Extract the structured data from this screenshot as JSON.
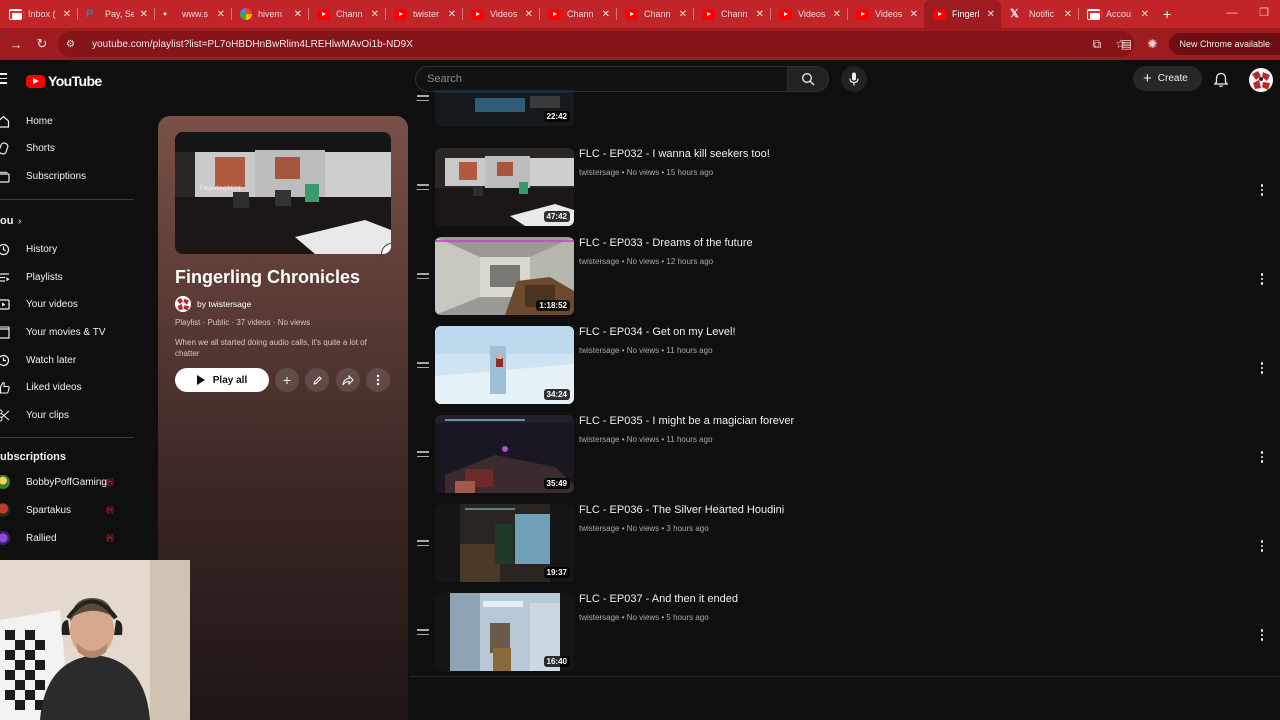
{
  "browser": {
    "tabs": [
      {
        "label": "Inbox (",
        "icon": "gmail-icon"
      },
      {
        "label": "Pay, Se",
        "icon": "paypal-icon"
      },
      {
        "label": "www.s",
        "icon": "web-icon"
      },
      {
        "label": "hivem",
        "icon": "google-icon"
      },
      {
        "label": "Chann",
        "icon": "youtube-icon"
      },
      {
        "label": "twister",
        "icon": "youtube-icon"
      },
      {
        "label": "Videos",
        "icon": "youtube-icon"
      },
      {
        "label": "Chann",
        "icon": "youtube-icon"
      },
      {
        "label": "Chann",
        "icon": "youtube-icon"
      },
      {
        "label": "Chann",
        "icon": "youtube-icon"
      },
      {
        "label": "Videos",
        "icon": "youtube-icon"
      },
      {
        "label": "Videos",
        "icon": "youtube-icon"
      },
      {
        "label": "Fingerl",
        "icon": "youtube-icon",
        "active": true
      },
      {
        "label": "Notific",
        "icon": "x-icon"
      },
      {
        "label": "Accou",
        "icon": "gmail-icon"
      }
    ],
    "url": "youtube.com/playlist?list=PL7oHBDHnBwRlim4LREHlwMAvOi1b-ND9X",
    "chrome_notice": "New Chrome available",
    "colors": {
      "tabstrip": "#c1252a",
      "toolbar": "#9e1b20"
    }
  },
  "masthead": {
    "logo_text": "YouTube",
    "search_placeholder": "Search",
    "create_label": "Create"
  },
  "sidebar": {
    "main": [
      {
        "label": "Home",
        "icon": "home-icon"
      },
      {
        "label": "Shorts",
        "icon": "shorts-icon"
      },
      {
        "label": "Subscriptions",
        "icon": "subscriptions-icon"
      }
    ],
    "you_header": "ou",
    "you": [
      {
        "label": "History",
        "icon": "history-icon"
      },
      {
        "label": "Playlists",
        "icon": "playlists-icon"
      },
      {
        "label": "Your videos",
        "icon": "your-videos-icon"
      },
      {
        "label": "Your movies & TV",
        "icon": "movies-icon"
      },
      {
        "label": "Watch later",
        "icon": "watch-later-icon"
      },
      {
        "label": "Liked videos",
        "icon": "like-icon"
      },
      {
        "label": "Your clips",
        "icon": "clips-icon"
      }
    ],
    "subs_header": "ubscriptions",
    "subscriptions": [
      {
        "label": "BobbyPoffGaming",
        "live": "((•))"
      },
      {
        "label": "Spartakus",
        "live": "((•))"
      },
      {
        "label": "Rallied",
        "live": "((•))"
      }
    ]
  },
  "playlist": {
    "title": "Fingerling Chronicles",
    "owner": "by twistersage",
    "meta": "Playlist · Public · 37 videos · No views",
    "description": "When we all started doing audio calls, it's quite a lot of chatter",
    "play_all_label": "Play all"
  },
  "videos": [
    {
      "title": "",
      "channel": "",
      "duration": "22:42"
    },
    {
      "title": "FLC - EP032 - I wanna kill seekers too!",
      "channel": "twistersage",
      "meta": "No views • 15 hours ago",
      "duration": "47:42"
    },
    {
      "title": "FLC - EP033 - Dreams of the future",
      "channel": "twistersage",
      "meta": "No views • 12 hours ago",
      "duration": "1:18:52"
    },
    {
      "title": "FLC - EP034 - Get on my Level!",
      "channel": "twistersage",
      "meta": "No views • 11 hours ago",
      "duration": "34:24"
    },
    {
      "title": "FLC - EP035 - I might be a magician forever",
      "channel": "twistersage",
      "meta": "No views • 11 hours ago",
      "duration": "35:49"
    },
    {
      "title": "FLC - EP036 - The Silver Hearted Houdini",
      "channel": "twistersage",
      "meta": "No views • 3 hours ago",
      "duration": "19:37"
    },
    {
      "title": "FLC - EP037 - And then it ended",
      "channel": "twistersage",
      "meta": "No views • 5 hours ago",
      "duration": "16:40"
    }
  ]
}
